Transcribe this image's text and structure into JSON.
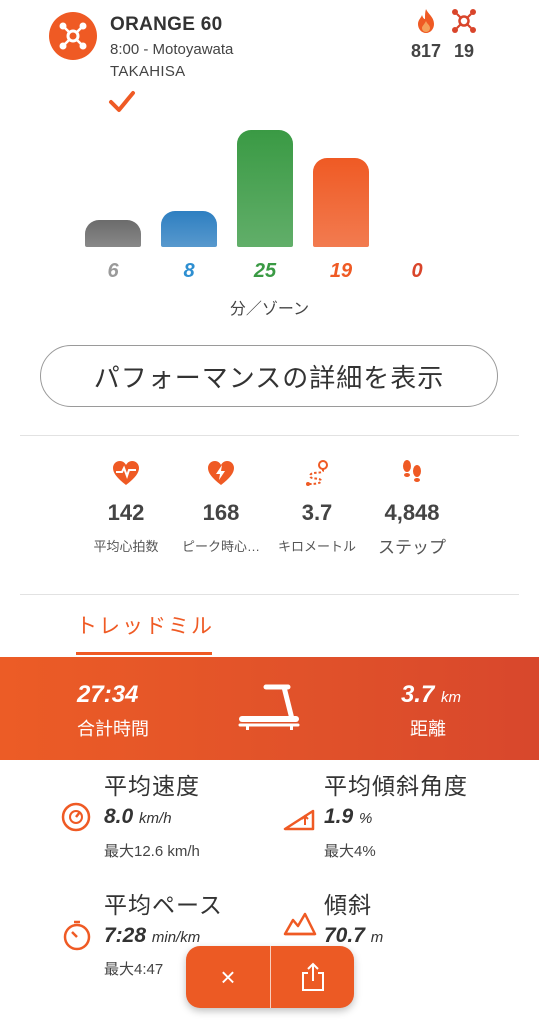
{
  "header": {
    "title": "ORANGE 60",
    "time_location": "8:00 - Motoyawata",
    "coach": "TAKAHISA",
    "calories": "817",
    "splat_points": "19"
  },
  "zones": {
    "values": [
      "6",
      "8",
      "25",
      "19",
      "0"
    ],
    "colors": [
      "#6b6b6b",
      "#2e7fc1",
      "#3a9a44",
      "#ef5a24",
      "#d9452b"
    ],
    "label_colors": [
      "#9a9a9a",
      "#2e8fd1",
      "#3a9a44",
      "#ef5a24",
      "#d9452b"
    ],
    "caption": "分／ゾーン"
  },
  "performance_button": "パフォーマンスの詳細を表示",
  "metrics": [
    {
      "icon": "heart-rate-icon",
      "value": "142",
      "label": "平均心拍数"
    },
    {
      "icon": "peak-heart-icon",
      "value": "168",
      "label": "ピーク時心…"
    },
    {
      "icon": "route-icon",
      "value": "3.7",
      "label": "キロメートル"
    },
    {
      "icon": "footsteps-icon",
      "value": "4,848",
      "label": "ステップ"
    }
  ],
  "tab": {
    "label": "トレッドミル"
  },
  "treadmill_summary": {
    "time": "27:34",
    "time_label": "合計時間",
    "distance": "3.7",
    "distance_unit": "km",
    "distance_label": "距離"
  },
  "stats": {
    "avg_speed": {
      "title": "平均速度",
      "value": "8.0",
      "unit": "km/h",
      "max": "最大12.6 km/h"
    },
    "avg_incline": {
      "title": "平均傾斜角度",
      "value": "1.9",
      "unit": "%",
      "max": "最大4%"
    },
    "avg_pace": {
      "title": "平均ペース",
      "value": "7:28",
      "unit": "min/km",
      "max": "最大4:47"
    },
    "elevation": {
      "title": "傾斜",
      "value": "70.7",
      "unit": "m"
    }
  },
  "actions": {
    "close": "×"
  },
  "colors": {
    "accent": "#ef5a24",
    "text": "#333333"
  }
}
